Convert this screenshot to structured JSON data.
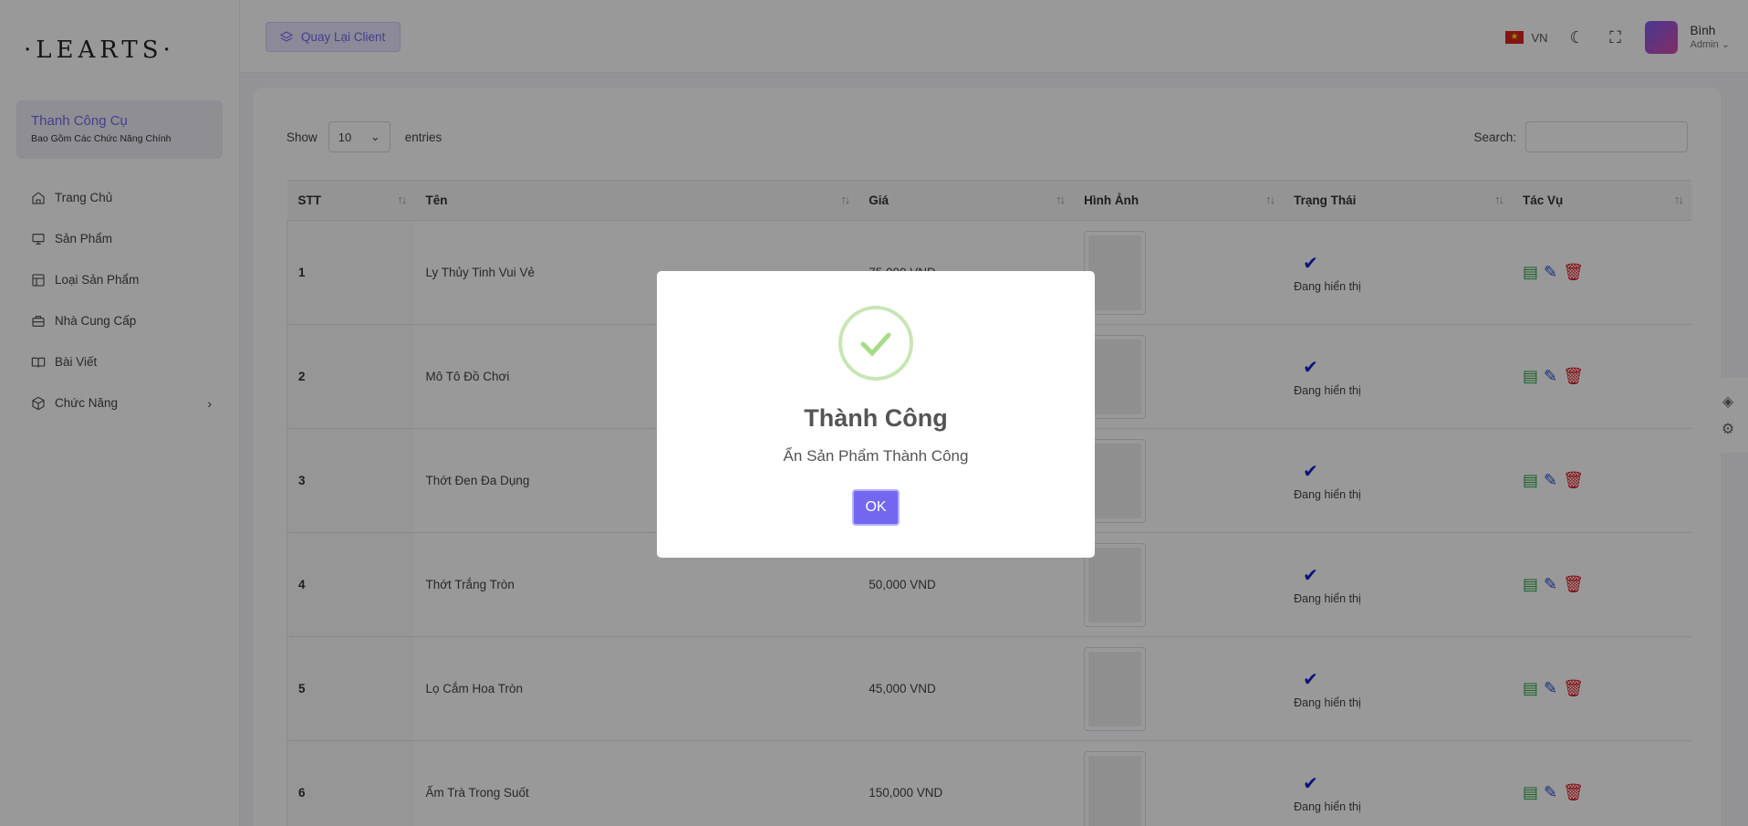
{
  "app": {
    "logo": "·LEARTS·"
  },
  "sidebar": {
    "header_title": "Thanh Công Cụ",
    "header_subtitle": "Bao Gồm Các Chức Năng Chính",
    "items": [
      {
        "label": "Trang Chủ",
        "icon": "home-icon"
      },
      {
        "label": "Sản Phẩm",
        "icon": "monitor-icon"
      },
      {
        "label": "Loại Sản Phẩm",
        "icon": "layout-icon"
      },
      {
        "label": "Nhà Cung Cấp",
        "icon": "briefcase-icon"
      },
      {
        "label": "Bài Viết",
        "icon": "book-icon"
      },
      {
        "label": "Chức Năng",
        "icon": "box-icon"
      }
    ]
  },
  "topbar": {
    "back_label": "Quay Lại Client",
    "lang": "VN",
    "user_name": "Bình",
    "user_role": "Admin"
  },
  "table": {
    "show_label": "Show",
    "entries_value": "10",
    "entries_label": "entries",
    "search_label": "Search:",
    "columns": [
      "STT",
      "Tên",
      "Giá",
      "Hình Ảnh",
      "Trạng Thái",
      "Tác Vụ"
    ],
    "rows": [
      {
        "stt": "1",
        "name": "Ly Thủy Tinh Vui Vẻ",
        "price": "75,000 VND",
        "status": "Đang hiển thị"
      },
      {
        "stt": "2",
        "name": "Mô Tô Đồ Chơi",
        "price": "",
        "status": "Đang hiển thị"
      },
      {
        "stt": "3",
        "name": "Thớt Đen Đa Dụng",
        "price": "",
        "status": "Đang hiển thị"
      },
      {
        "stt": "4",
        "name": "Thớt Trắng Tròn",
        "price": "50,000 VND",
        "status": "Đang hiển thị"
      },
      {
        "stt": "5",
        "name": "Lọ Cắm Hoa Tròn",
        "price": "45,000 VND",
        "status": "Đang hiển thị"
      },
      {
        "stt": "6",
        "name": "Ấm Trà Trong Suốt",
        "price": "150,000 VND",
        "status": "Đang hiển thị"
      }
    ]
  },
  "modal": {
    "title": "Thành Công",
    "message": "Ẩn Sản Phẩm Thành Công",
    "ok_label": "OK"
  },
  "colors": {
    "accent": "#7367f0",
    "success": "#a5dc86"
  }
}
